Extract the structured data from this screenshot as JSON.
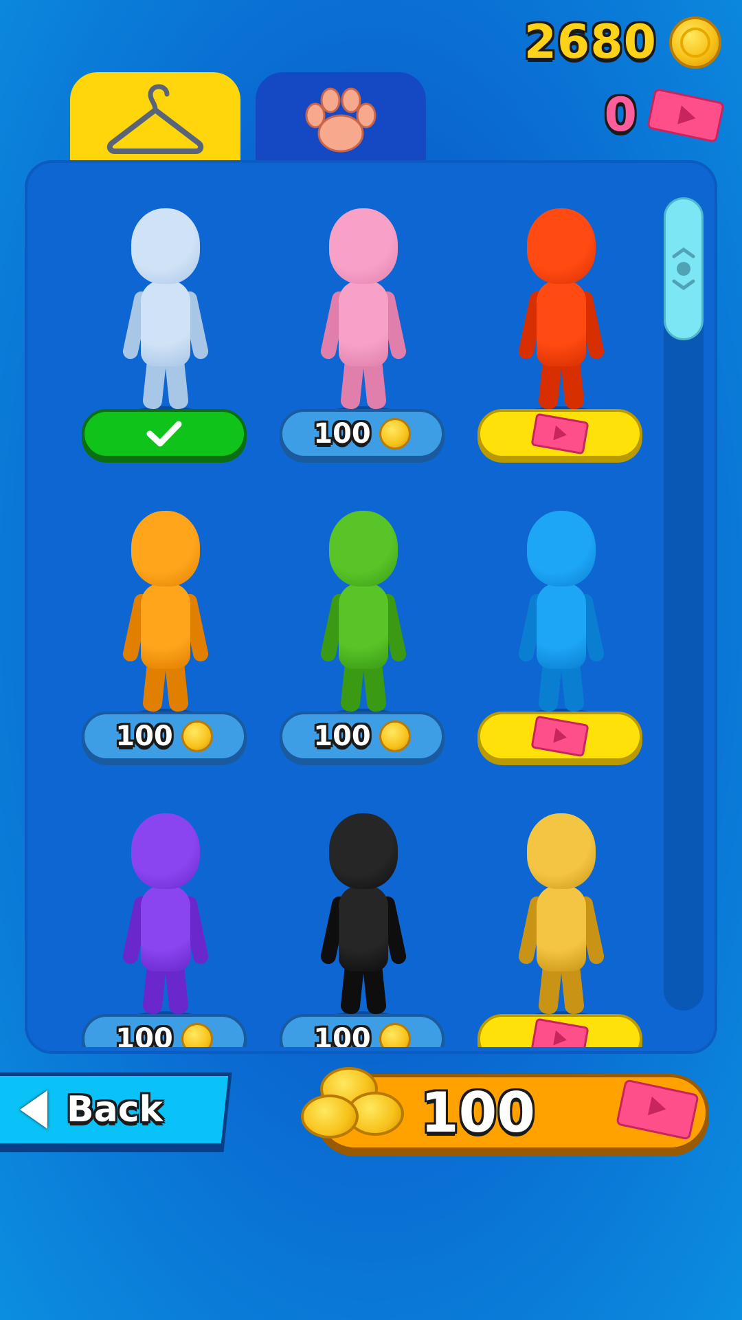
{
  "currency": {
    "coins": "2680",
    "tickets": "0"
  },
  "tabs": [
    {
      "name": "outfits",
      "icon": "hanger-icon",
      "active": true
    },
    {
      "name": "pets",
      "icon": "paw-icon",
      "active": false
    }
  ],
  "skins": [
    {
      "color": "#cfe2f6",
      "shade": "#a8c6e6",
      "button": "owned"
    },
    {
      "color": "#f7a1c7",
      "shade": "#e07fab",
      "button": "price",
      "price": "100"
    },
    {
      "color": "#ff4a12",
      "shade": "#d82f00",
      "button": "ad"
    },
    {
      "color": "#ffa51c",
      "shade": "#e07f00",
      "button": "price",
      "price": "100"
    },
    {
      "color": "#58c428",
      "shade": "#3a9a14",
      "button": "price",
      "price": "100"
    },
    {
      "color": "#1ea6f6",
      "shade": "#0a7fd2",
      "button": "ad"
    },
    {
      "color": "#8a44f0",
      "shade": "#6a28cc",
      "button": "price",
      "price": "100"
    },
    {
      "color": "#262626",
      "shade": "#0e0e0e",
      "button": "price",
      "price": "100"
    },
    {
      "color": "#f4c542",
      "shade": "#c99416",
      "button": "ad"
    }
  ],
  "bottom": {
    "back_label": "Back",
    "offer_amount": "100"
  }
}
